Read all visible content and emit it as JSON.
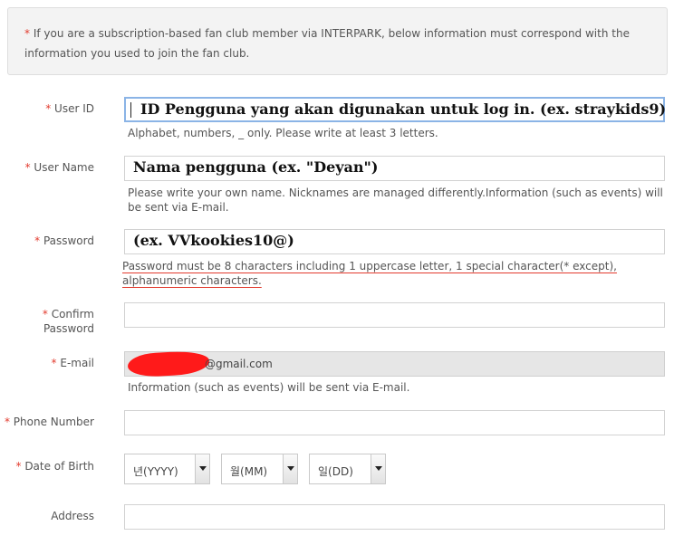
{
  "notice": {
    "asterisk": "*",
    "text": "If you are a subscription-based fan club member via INTERPARK, below information must correspond with the information you used to join the fan club."
  },
  "fields": {
    "user_id": {
      "label": "User ID",
      "overlay": "ID Pengguna yang akan digunakan untuk log in. (ex. straykids9)",
      "help": "Alphabet, numbers, _ only. Please write at least 3 letters."
    },
    "user_name": {
      "label": "User Name",
      "overlay": "Nama pengguna (ex. \"Deyan\")",
      "help": "Please write your own name. Nicknames are managed differently.Information (such as events) will be sent via E-mail."
    },
    "password": {
      "label": "Password",
      "overlay": "(ex. VVkookies10@)",
      "help": "Password must be 8 characters including 1 uppercase letter, 1 special character(* except), alphanumeric characters."
    },
    "confirm_password": {
      "label_line1": "Confirm",
      "label_line2": "Password"
    },
    "email": {
      "label": "E-mail",
      "value_suffix": "@gmail.com",
      "help": "Information (such as events) will be sent via E-mail."
    },
    "phone": {
      "label": "Phone Number"
    },
    "dob": {
      "label": "Date of Birth",
      "year": "년(YYYY)",
      "month": "월(MM)",
      "day": "일(DD)"
    },
    "address": {
      "label": "Address"
    }
  },
  "required_mark": "*",
  "colors": {
    "required": "#e23b2e",
    "highlight_border": "#8bb4e6",
    "redaction": "#ff1a1a"
  }
}
